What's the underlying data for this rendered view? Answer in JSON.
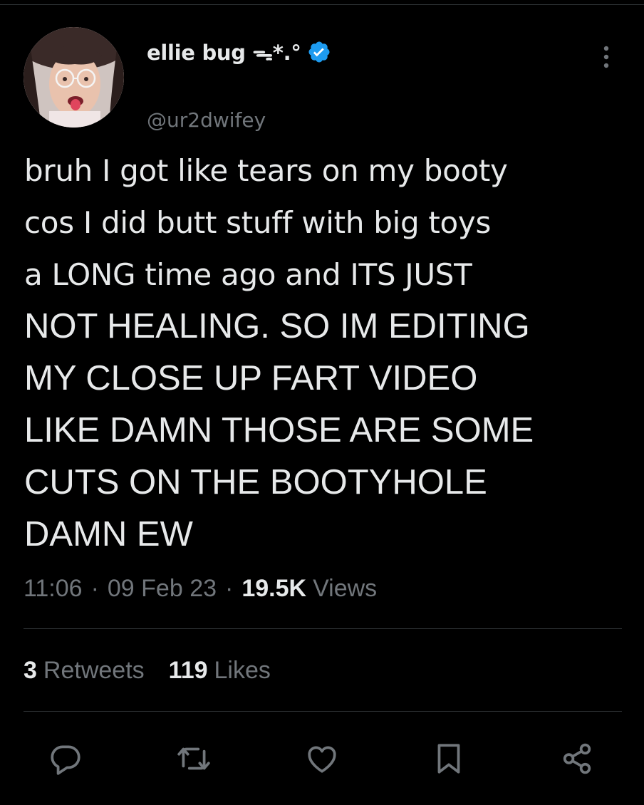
{
  "author": {
    "display_name": "ellie bug ᯓ*.°",
    "handle": "@ur2dwifey",
    "verified": true,
    "verified_color": "#1d9bf0"
  },
  "tweet": {
    "lines": [
      "bruh I got like tears on my booty",
      "cos I did butt stuff with big toys",
      "a LONG time ago and ITS JUST",
      "NOT HEALING. SO IM EDITING",
      "MY CLOSE UP FART VIDEO",
      "LIKE DAMN THOSE ARE SOME",
      "CUTS ON THE BOOTYHOLE",
      "DAMN EW"
    ]
  },
  "meta": {
    "time": "11:06",
    "separator": "·",
    "date": "09 Feb 23",
    "views_count": "19.5K",
    "views_label": "Views"
  },
  "stats": {
    "retweets_count": "3",
    "retweets_label": "Retweets",
    "likes_count": "119",
    "likes_label": "Likes"
  },
  "actions": [
    "reply-icon",
    "retweet-icon",
    "like-icon",
    "bookmark-icon",
    "share-icon"
  ],
  "colors": {
    "background": "#000000",
    "text_primary": "#e7e9ea",
    "text_secondary": "#71767b",
    "divider": "#2f3336"
  }
}
